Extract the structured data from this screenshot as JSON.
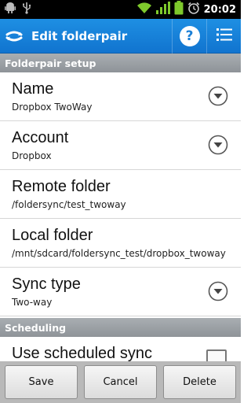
{
  "status_bar": {
    "time": "20:02",
    "icons": [
      "android-icon",
      "usb-icon",
      "wifi-icon",
      "signal-icon",
      "battery-icon",
      "alarm-icon"
    ]
  },
  "action_bar": {
    "title": "Edit folderpair",
    "help_label": "?",
    "accent_color": "#1a7fd6"
  },
  "sections": {
    "setup_header": "Folderpair setup",
    "scheduling_header": "Scheduling"
  },
  "prefs": [
    {
      "title": "Name",
      "summary": "Dropbox TwoWay",
      "control": "dropdown"
    },
    {
      "title": "Account",
      "summary": "Dropbox",
      "control": "dropdown"
    },
    {
      "title": "Remote folder",
      "summary": "/foldersync/test_twoway",
      "control": "none"
    },
    {
      "title": "Local folder",
      "summary": "/mnt/sdcard/foldersync_test/dropbox_twoway",
      "control": "none"
    },
    {
      "title": "Sync type",
      "summary": "Two-way",
      "control": "dropdown"
    }
  ],
  "scheduling": {
    "scheduled_sync_title": "Use scheduled sync",
    "checked": false
  },
  "buttons": {
    "save": "Save",
    "cancel": "Cancel",
    "delete": "Delete"
  }
}
